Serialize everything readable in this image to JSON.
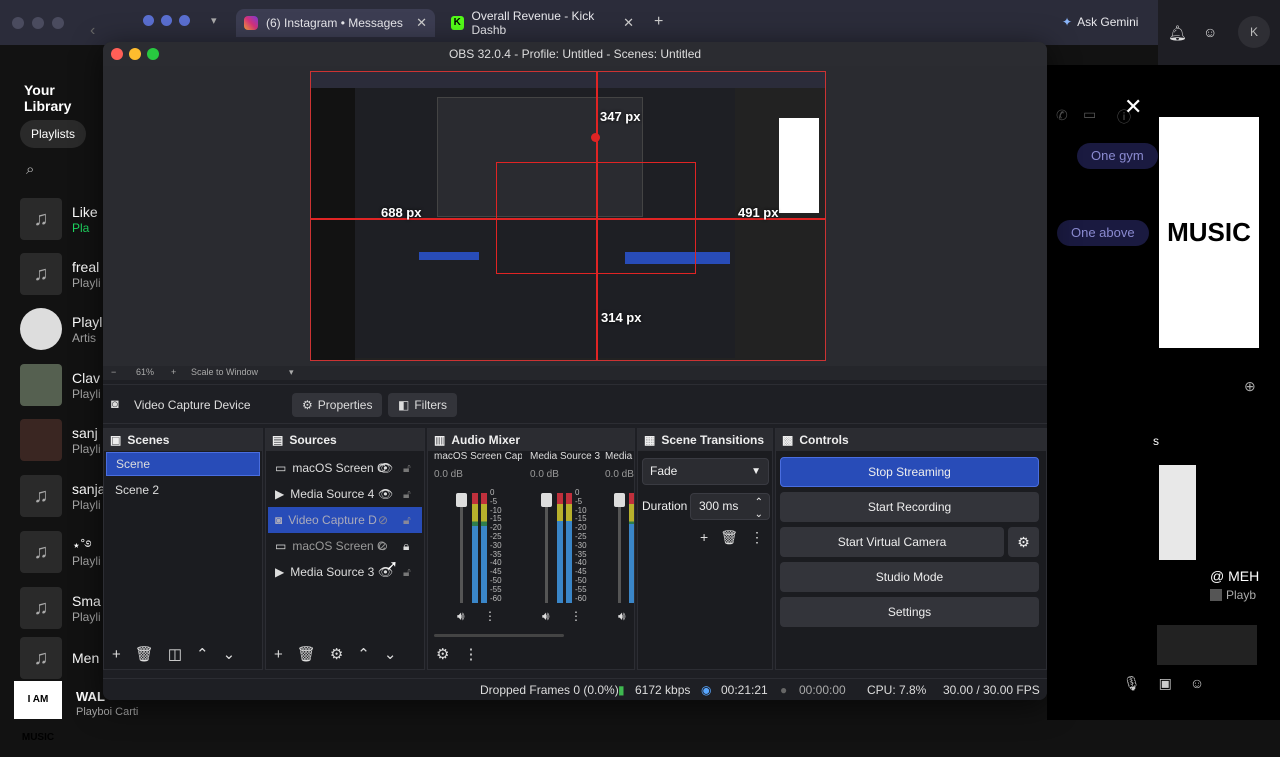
{
  "browser": {
    "tabs": [
      {
        "label": "(6) Instagram • Messages",
        "active": true
      },
      {
        "label": "Overall Revenue - Kick Dashb",
        "active": false
      }
    ],
    "gemini_label": "Ask Gemini",
    "profile_initial": "K"
  },
  "spotify": {
    "title": "Your Library",
    "filter_chip": "Playlists",
    "items": [
      {
        "title": "Like",
        "sub": "Pla"
      },
      {
        "title": "freal",
        "sub": "Playli"
      },
      {
        "title": "Playl",
        "sub": "Artis"
      },
      {
        "title": "Clav",
        "sub": "Playli"
      },
      {
        "title": "sanj",
        "sub": "Playli"
      },
      {
        "title": "sanja",
        "sub": "Playli"
      },
      {
        "title": "⋆˚࿔",
        "sub": "Playli"
      },
      {
        "title": "Sma",
        "sub": "Playli"
      },
      {
        "title": "Men",
        "sub": ""
      }
    ],
    "now_playing": {
      "title": "WAL",
      "sub": "Playboi Carti",
      "art_text": "I AM MUSIC"
    }
  },
  "chat": {
    "bubbles": [
      "One gym",
      "One above"
    ],
    "art_text": "MUSIC",
    "user_label": "@ MEH",
    "user_sub": "Playb",
    "side_label": "s"
  },
  "obs": {
    "title": "OBS 32.0.4 - Profile: Untitled - Scenes: Untitled",
    "preview": {
      "measure_top": "347 px",
      "measure_left": "688 px",
      "measure_right": "491 px",
      "measure_bottom": "314 px"
    },
    "zoom": {
      "minus": "−",
      "percent": "61%",
      "plus": "+",
      "mode": "Scale to Window"
    },
    "source_toolbar": {
      "source_name": "Video Capture Device",
      "properties_label": "Properties",
      "filters_label": "Filters"
    },
    "scenes": {
      "title": "Scenes",
      "items": [
        {
          "label": "Scene",
          "selected": true
        },
        {
          "label": "Scene 2",
          "selected": false
        }
      ]
    },
    "sources": {
      "title": "Sources",
      "items": [
        {
          "label": "macOS Screen C",
          "icon": "monitor-icon",
          "visible": true,
          "locked": false,
          "selected": false
        },
        {
          "label": "Media Source 4",
          "icon": "play-icon",
          "visible": true,
          "locked": false,
          "selected": false
        },
        {
          "label": "Video Capture D",
          "icon": "camera-icon",
          "visible": false,
          "locked": false,
          "selected": true
        },
        {
          "label": "macOS Screen C",
          "icon": "monitor-icon",
          "visible": false,
          "locked": true,
          "selected": false
        },
        {
          "label": "Media Source 3",
          "icon": "play-icon",
          "visible": true,
          "locked": false,
          "selected": false
        }
      ]
    },
    "audio_mixer": {
      "title": "Audio Mixer",
      "channels": [
        {
          "name": "macOS Screen Captur",
          "db": "0.0 dB",
          "level": 0.7
        },
        {
          "name": "Media Source 3",
          "db": "0.0 dB",
          "level": 0.75
        },
        {
          "name": "Media S",
          "db": "0.0 dB",
          "level": 0.72
        }
      ],
      "scale": [
        "0",
        "-5",
        "-10",
        "-15",
        "-20",
        "-25",
        "-30",
        "-35",
        "-40",
        "-45",
        "-50",
        "-55",
        "-60"
      ]
    },
    "scene_transitions": {
      "title": "Scene Transitions",
      "transition": "Fade",
      "duration_label": "Duration",
      "duration_value": "300 ms"
    },
    "controls": {
      "title": "Controls",
      "stop_streaming": "Stop Streaming",
      "start_recording": "Start Recording",
      "start_virtual_camera": "Start Virtual Camera",
      "studio_mode": "Studio Mode",
      "settings": "Settings"
    },
    "status": {
      "dropped_frames": "Dropped Frames 0 (0.0%)",
      "bitrate": "6172 kbps",
      "stream_time": "00:21:21",
      "record_time": "00:00:00",
      "cpu": "CPU: 7.8%",
      "fps": "30.00 / 30.00 FPS"
    },
    "colors": {
      "accent": "#284cb8",
      "live": "#e02424",
      "bitrate_green": "#3fb950"
    }
  }
}
